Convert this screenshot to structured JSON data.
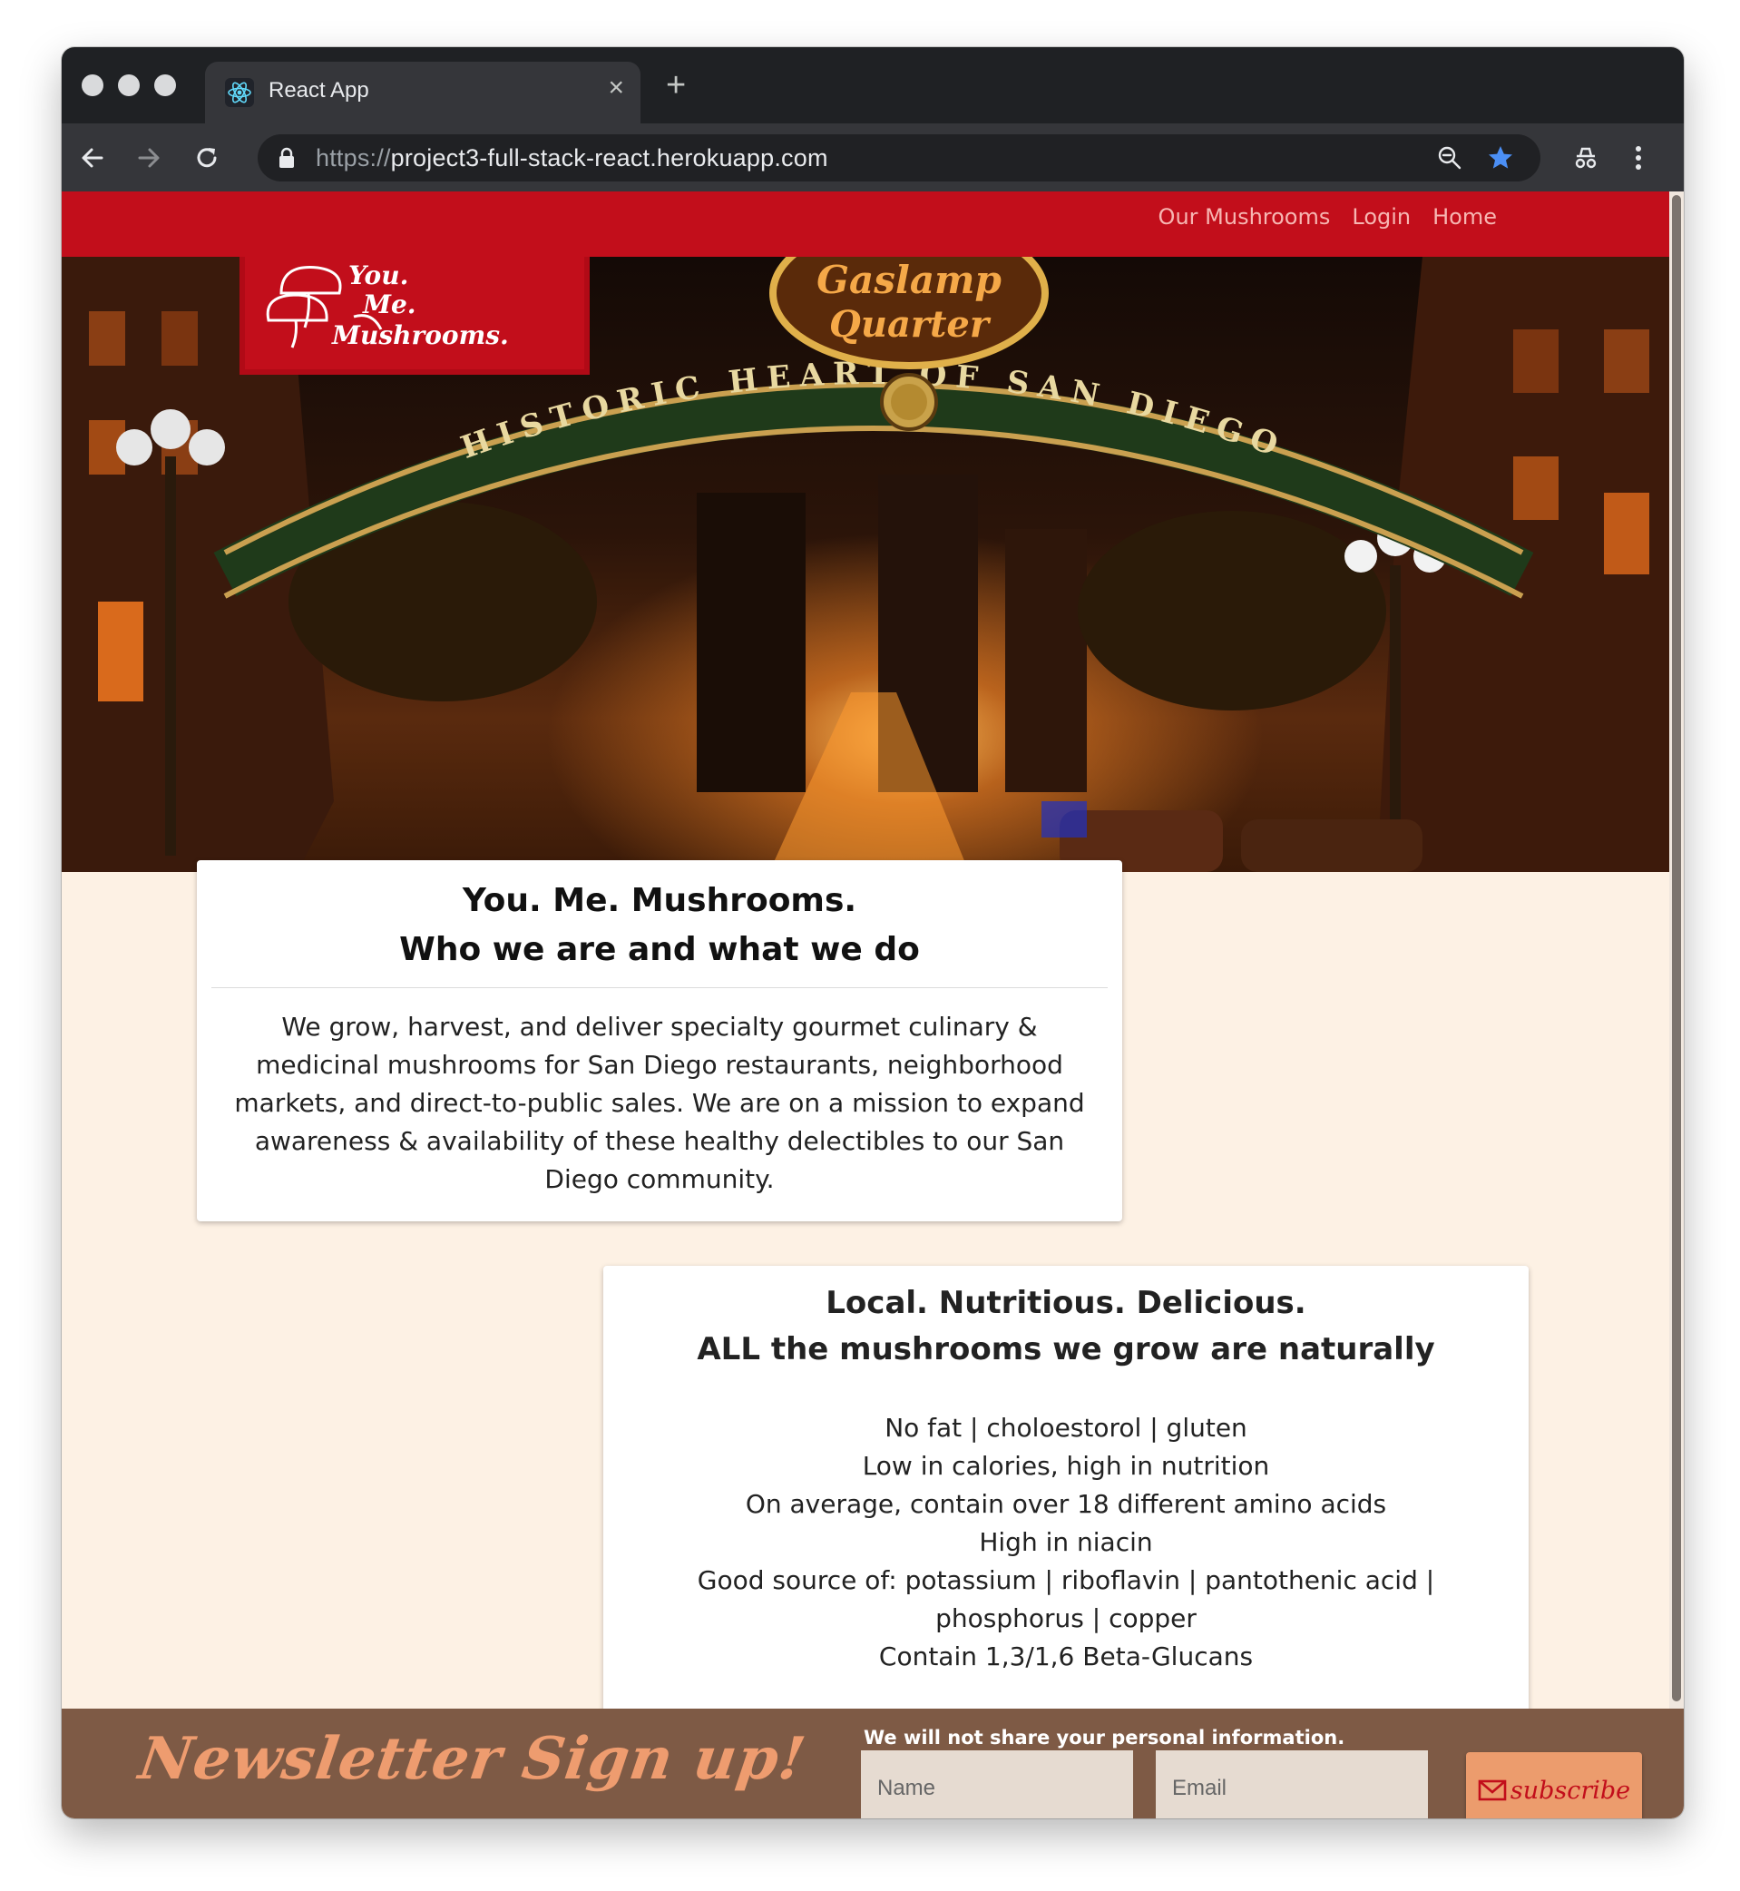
{
  "browser": {
    "tab_title": "React App",
    "tab_close": "×",
    "new_tab": "+",
    "url_scheme": "https://",
    "url_host": "project3-full-stack-react.herokuapp.com"
  },
  "nav": {
    "links": [
      "Our Mushrooms",
      "Login",
      "Home"
    ]
  },
  "hero": {
    "logo_lines": [
      "You.",
      "Me.",
      "Mushrooms."
    ],
    "sign_top_lines": [
      "Gaslamp",
      "Quarter"
    ],
    "sign_arch_text": "HISTORIC HEART OF SAN DIEGO"
  },
  "about": {
    "title_line1": "You. Me. Mushrooms.",
    "title_line2": "Who we are and what we do",
    "body": "We grow, harvest, and deliver specialty gourmet culinary & medicinal mushrooms for San Diego restaurants, neighborhood markets, and direct-to-public sales. We are on a mission to expand awareness & availability of these healthy delectibles to our San Diego community."
  },
  "nutrition": {
    "title_line1": "Local. Nutritious. Delicious.",
    "title_line2": "ALL the mushrooms we grow are naturally",
    "items": [
      "No fat | choloestorol | gluten",
      "Low in calories, high in nutrition",
      "On average, contain over 18 different amino acids",
      "High in niacin",
      "Good source of: potassium | riboflavin | pantothenic acid | phosphorus | copper",
      "Contain 1,3/1,6 Beta-Glucans"
    ]
  },
  "newsletter": {
    "title": "Newsletter Sign up!",
    "privacy_note": "We will not share your personal information.",
    "name_placeholder": "Name",
    "email_placeholder": "Email",
    "subscribe_label": "subscribe"
  },
  "colors": {
    "brand_red": "#c20e1b",
    "footer_brown": "#7e5a45",
    "accent_orange": "#ec9c6d",
    "page_cream": "#fdf1e4"
  }
}
